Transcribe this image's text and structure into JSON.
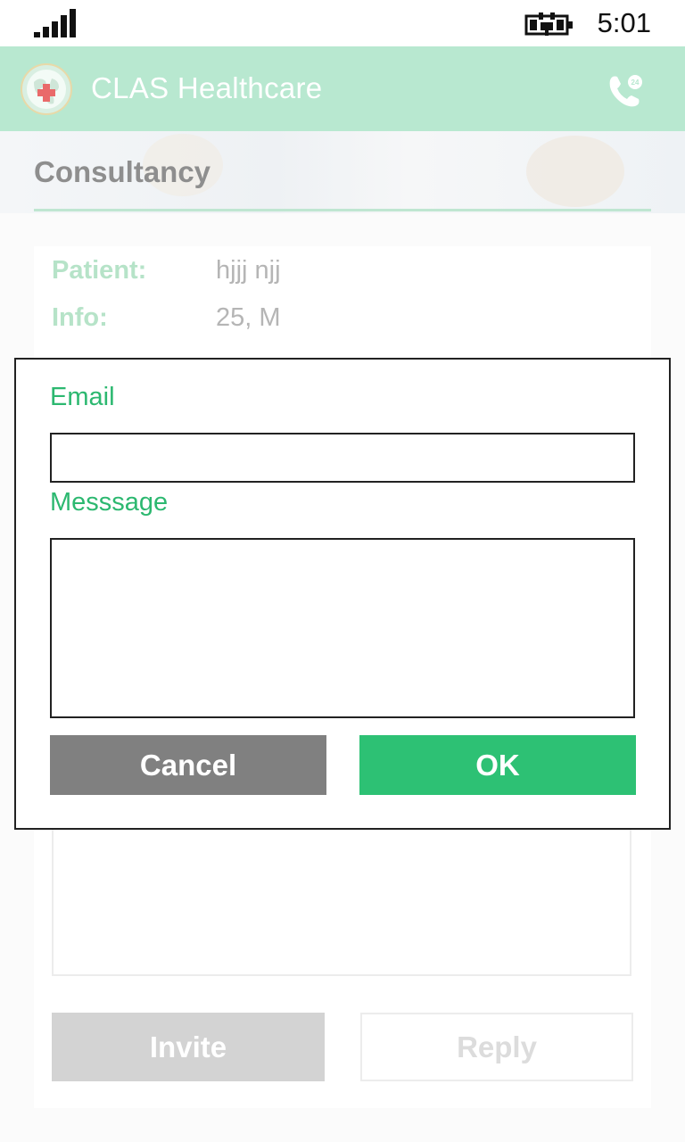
{
  "status_bar": {
    "time": "5:01",
    "signal_icon": "signal-strength-icon",
    "battery_icon": "battery-charging-icon"
  },
  "app_bar": {
    "title": "CLAS Healthcare",
    "logo_icon": "globe-medical-logo",
    "call_icon": "phone-24h-icon",
    "background": "#b8e8d0"
  },
  "page": {
    "title": "Consultancy"
  },
  "patient_card": {
    "patient_label": "Patient:",
    "patient_value": "hjjj njj",
    "info_label": "Info:",
    "info_value": "25, M"
  },
  "actions": {
    "invite_label": "Invite",
    "reply_label": "Reply"
  },
  "dialog": {
    "email_label": "Email",
    "email_value": "",
    "message_label": "Messsage",
    "message_value": "",
    "cancel_label": "Cancel",
    "ok_label": "OK",
    "accent_color": "#2dc174",
    "cancel_color": "#808080"
  }
}
